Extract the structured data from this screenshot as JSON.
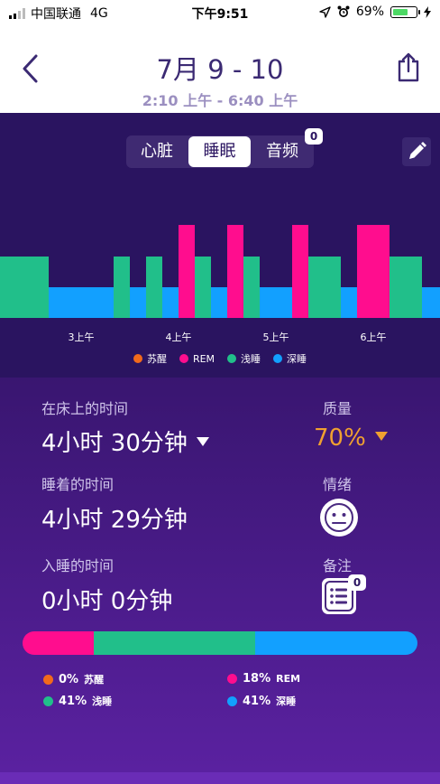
{
  "status_bar": {
    "carrier": "中国联通",
    "network": "4G",
    "time": "下午9:51",
    "battery": "69%",
    "battery_level": 0.69
  },
  "header": {
    "title": "7月 9 - 10",
    "subtitle": "2:10 上午 - 6:40 上午"
  },
  "tabs": [
    {
      "label": "心脏",
      "active": false
    },
    {
      "label": "睡眠",
      "active": true
    },
    {
      "label": "音频",
      "active": false,
      "badge": "0"
    }
  ],
  "colors": {
    "awake": "#f26a1b",
    "rem": "#ff0d8e",
    "light": "#21bf8a",
    "deep": "#12a0ff"
  },
  "chart_data": {
    "type": "bar",
    "x_ticks": [
      "3上午",
      "4上午",
      "5上午",
      "6上午"
    ],
    "legend": [
      "苏醒",
      "REM",
      "浅睡",
      "深睡"
    ],
    "stages": [
      {
        "start": 0,
        "end": 54,
        "stage": "light"
      },
      {
        "start": 54,
        "end": 126,
        "stage": "deep"
      },
      {
        "start": 126,
        "end": 144,
        "stage": "light"
      },
      {
        "start": 144,
        "end": 162,
        "stage": "deep"
      },
      {
        "start": 162,
        "end": 180,
        "stage": "light"
      },
      {
        "start": 180,
        "end": 198,
        "stage": "deep"
      },
      {
        "start": 198,
        "end": 216,
        "stage": "rem"
      },
      {
        "start": 216,
        "end": 234,
        "stage": "light"
      },
      {
        "start": 234,
        "end": 252,
        "stage": "deep"
      },
      {
        "start": 252,
        "end": 270,
        "stage": "rem"
      },
      {
        "start": 270,
        "end": 288,
        "stage": "light"
      },
      {
        "start": 288,
        "end": 324,
        "stage": "deep"
      },
      {
        "start": 324,
        "end": 342,
        "stage": "rem"
      },
      {
        "start": 342,
        "end": 378,
        "stage": "light"
      },
      {
        "start": 378,
        "end": 396,
        "stage": "deep"
      },
      {
        "start": 396,
        "end": 432,
        "stage": "rem"
      },
      {
        "start": 432,
        "end": 468,
        "stage": "light"
      },
      {
        "start": 468,
        "end": 488,
        "stage": "deep"
      }
    ]
  },
  "summary": {
    "in_bed_label": "在床上的时间",
    "in_bed_value": "4小时 30分钟",
    "quality_label": "质量",
    "quality_value": "70%",
    "asleep_label": "睡着的时间",
    "asleep_value": "4小时 29分钟",
    "mood_label": "情绪",
    "fall_asleep_label": "入睡的时间",
    "fall_asleep_value": "0小时 0分钟",
    "notes_label": "备注",
    "notes_badge": "0"
  },
  "breakdown": [
    {
      "pct": "0%",
      "name": "苏醒",
      "stage": "awake",
      "fraction": 0
    },
    {
      "pct": "18%",
      "name": "REM",
      "stage": "rem",
      "fraction": 0.18
    },
    {
      "pct": "41%",
      "name": "浅睡",
      "stage": "light",
      "fraction": 0.41
    },
    {
      "pct": "41%",
      "name": "深睡",
      "stage": "deep",
      "fraction": 0.41
    }
  ]
}
